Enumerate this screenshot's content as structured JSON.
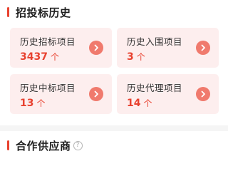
{
  "colors": {
    "accent": "#e8412f",
    "card_background": "#fdeeee",
    "arrow_button": "#f07a6d"
  },
  "history_section": {
    "title": "招投标历史",
    "cards": [
      {
        "label": "历史招标项目",
        "value": "3437",
        "unit": "个",
        "icon": "chevron-right-icon"
      },
      {
        "label": "历史入围项目",
        "value": "3",
        "unit": "个",
        "icon": "chevron-right-icon"
      },
      {
        "label": "历史中标项目",
        "value": "13",
        "unit": "个",
        "icon": "chevron-right-icon"
      },
      {
        "label": "历史代理项目",
        "value": "14",
        "unit": "个",
        "icon": "chevron-right-icon"
      }
    ]
  },
  "partners_section": {
    "title": "合作供应商",
    "help_icon_glyph": "?"
  }
}
